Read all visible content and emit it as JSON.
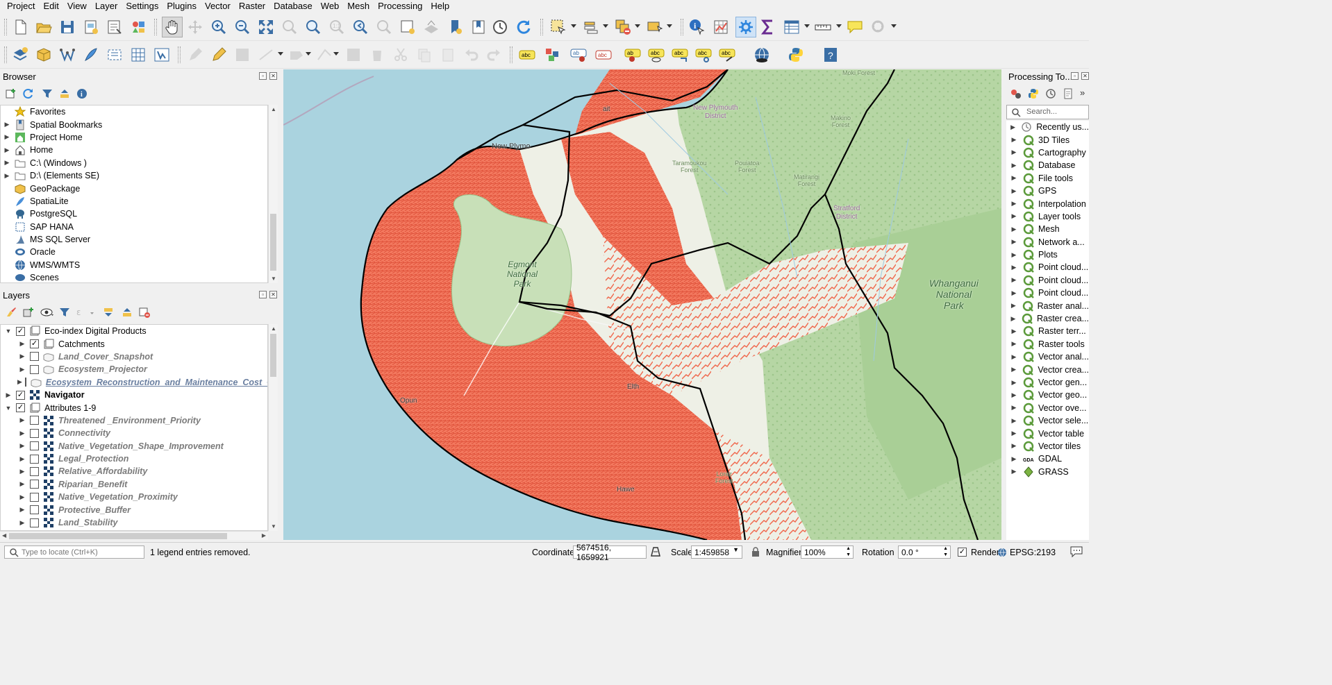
{
  "menu": [
    "Project",
    "Edit",
    "View",
    "Layer",
    "Settings",
    "Plugins",
    "Vector",
    "Raster",
    "Database",
    "Web",
    "Mesh",
    "Processing",
    "Help"
  ],
  "browser": {
    "title": "Browser",
    "items": [
      {
        "label": "Favorites",
        "icon": "star-icon",
        "expand": false
      },
      {
        "label": "Spatial Bookmarks",
        "icon": "bookmark-icon",
        "expand": true
      },
      {
        "label": "Project Home",
        "icon": "project-home-icon",
        "expand": true
      },
      {
        "label": "Home",
        "icon": "home-icon",
        "expand": true
      },
      {
        "label": "C:\\ (Windows )",
        "icon": "folder-icon",
        "expand": true
      },
      {
        "label": "D:\\ (Elements SE)",
        "icon": "folder-icon",
        "expand": true
      },
      {
        "label": "GeoPackage",
        "icon": "geopackage-icon",
        "expand": false
      },
      {
        "label": "SpatiaLite",
        "icon": "spatialite-icon",
        "expand": false
      },
      {
        "label": "PostgreSQL",
        "icon": "postgresql-icon",
        "expand": false
      },
      {
        "label": "SAP HANA",
        "icon": "sap-hana-icon",
        "expand": false
      },
      {
        "label": "MS SQL Server",
        "icon": "mssql-icon",
        "expand": false
      },
      {
        "label": "Oracle",
        "icon": "oracle-icon",
        "expand": false
      },
      {
        "label": "WMS/WMTS",
        "icon": "wms-icon",
        "expand": false
      },
      {
        "label": "Scenes",
        "icon": "scenes-icon",
        "expand": false
      }
    ]
  },
  "layers": {
    "title": "Layers",
    "items": [
      {
        "label": "Eco-index Digital Products",
        "level": 0,
        "checked": true,
        "expand": "open",
        "style": "normal",
        "icon": "group-icon"
      },
      {
        "label": "Catchments",
        "level": 1,
        "checked": true,
        "expand": "closed",
        "style": "normal",
        "icon": "group-icon"
      },
      {
        "label": "Land_Cover_Snapshot",
        "level": 1,
        "checked": false,
        "expand": "closed",
        "style": "italic",
        "icon": "polygon-layer-icon"
      },
      {
        "label": "Ecosystem_Projector",
        "level": 1,
        "checked": false,
        "expand": "closed",
        "style": "italic",
        "icon": "polygon-layer-icon"
      },
      {
        "label": "Ecosystem_Reconstruction_and_Maintenance_Cost_G",
        "level": 1,
        "checked": false,
        "expand": "closed",
        "style": "italic-underline",
        "icon": "polygon-layer-icon"
      },
      {
        "label": "Navigator",
        "level": 0,
        "checked": true,
        "expand": "closed",
        "style": "bold",
        "icon": "raster-layer-icon"
      },
      {
        "label": "Attributes 1-9",
        "level": 0,
        "checked": true,
        "expand": "open",
        "style": "normal",
        "icon": "group-icon"
      },
      {
        "label": "Threatened _Environment_Priority",
        "level": 1,
        "checked": false,
        "expand": "closed",
        "style": "italic",
        "icon": "raster-layer-icon"
      },
      {
        "label": "Connectivity",
        "level": 1,
        "checked": false,
        "expand": "closed",
        "style": "italic",
        "icon": "raster-layer-icon"
      },
      {
        "label": "Native_Vegetation_Shape_Improvement",
        "level": 1,
        "checked": false,
        "expand": "closed",
        "style": "italic",
        "icon": "raster-layer-icon"
      },
      {
        "label": "Legal_Protection",
        "level": 1,
        "checked": false,
        "expand": "closed",
        "style": "italic",
        "icon": "raster-layer-icon"
      },
      {
        "label": "Relative_Affordability",
        "level": 1,
        "checked": false,
        "expand": "closed",
        "style": "italic",
        "icon": "raster-layer-icon"
      },
      {
        "label": "Riparian_Benefit",
        "level": 1,
        "checked": false,
        "expand": "closed",
        "style": "italic",
        "icon": "raster-layer-icon"
      },
      {
        "label": "Native_Vegetation_Proximity",
        "level": 1,
        "checked": false,
        "expand": "closed",
        "style": "italic",
        "icon": "raster-layer-icon"
      },
      {
        "label": "Protective_Buffer",
        "level": 1,
        "checked": false,
        "expand": "closed",
        "style": "italic",
        "icon": "raster-layer-icon"
      },
      {
        "label": "Land_Stability",
        "level": 1,
        "checked": false,
        "expand": "closed",
        "style": "italic",
        "icon": "raster-layer-icon"
      }
    ]
  },
  "processing": {
    "title": "Processing To...",
    "search_placeholder": "Search...",
    "items": [
      {
        "label": "Recently us...",
        "icon": "clock-icon"
      },
      {
        "label": "3D Tiles",
        "icon": "qgis-icon"
      },
      {
        "label": "Cartography",
        "icon": "qgis-icon"
      },
      {
        "label": "Database",
        "icon": "qgis-icon"
      },
      {
        "label": "File tools",
        "icon": "qgis-icon"
      },
      {
        "label": "GPS",
        "icon": "qgis-icon"
      },
      {
        "label": "Interpolation",
        "icon": "qgis-icon"
      },
      {
        "label": "Layer tools",
        "icon": "qgis-icon"
      },
      {
        "label": "Mesh",
        "icon": "qgis-icon"
      },
      {
        "label": "Network a...",
        "icon": "qgis-icon"
      },
      {
        "label": "Plots",
        "icon": "qgis-icon"
      },
      {
        "label": "Point cloud...",
        "icon": "qgis-icon"
      },
      {
        "label": "Point cloud...",
        "icon": "qgis-icon"
      },
      {
        "label": "Point cloud...",
        "icon": "qgis-icon"
      },
      {
        "label": "Raster anal...",
        "icon": "qgis-icon"
      },
      {
        "label": "Raster crea...",
        "icon": "qgis-icon"
      },
      {
        "label": "Raster terr...",
        "icon": "qgis-icon"
      },
      {
        "label": "Raster tools",
        "icon": "qgis-icon"
      },
      {
        "label": "Vector anal...",
        "icon": "qgis-icon"
      },
      {
        "label": "Vector crea...",
        "icon": "qgis-icon"
      },
      {
        "label": "Vector gen...",
        "icon": "qgis-icon"
      },
      {
        "label": "Vector geo...",
        "icon": "qgis-icon"
      },
      {
        "label": "Vector ove...",
        "icon": "qgis-icon"
      },
      {
        "label": "Vector sele...",
        "icon": "qgis-icon"
      },
      {
        "label": "Vector table",
        "icon": "qgis-icon"
      },
      {
        "label": "Vector tiles",
        "icon": "qgis-icon"
      },
      {
        "label": "GDAL",
        "icon": "gdal-icon"
      },
      {
        "label": "GRASS",
        "icon": "grass-icon"
      }
    ]
  },
  "map": {
    "labels": {
      "egmont": "Egmont\nNational\nPark",
      "whanganui": "Whanganui\nNational\nPark",
      "new_plymouth": "New Plymouth\nDistrict",
      "stratford": "Stratford\nDistrict",
      "taramoukou": "Taramoukou\nForest",
      "pouiatoa": "Pouiatoa\nForest",
      "matirangi": "Matirangi\nForest",
      "makino": "Makino\nForest",
      "moki": "Moki Forest",
      "new_plymouth_town": "New Plymo",
      "inglewood": "ait",
      "opunake": "Opun",
      "eltham": "Elth",
      "hawera": "Hawe",
      "lorenz": "Lorez\nForest"
    },
    "colors": {
      "sea": "#aad3df",
      "land": "#f2efe9",
      "forest": "#add19e",
      "park": "#c8e0b8",
      "heat": "#f0694e",
      "boundary": "#000000"
    }
  },
  "status": {
    "locate_placeholder": "Type to locate (Ctrl+K)",
    "message": "1 legend entries removed.",
    "coordinate_label": "Coordinate",
    "coordinate_value": "5674516, 1659921",
    "scale_label": "Scale",
    "scale_value": "1:459858",
    "magnifier_label": "Magnifier",
    "magnifier_value": "100%",
    "rotation_label": "Rotation",
    "rotation_value": "0.0 °",
    "render_label": "Render",
    "render_checked": true,
    "crs": "EPSG:2193"
  }
}
